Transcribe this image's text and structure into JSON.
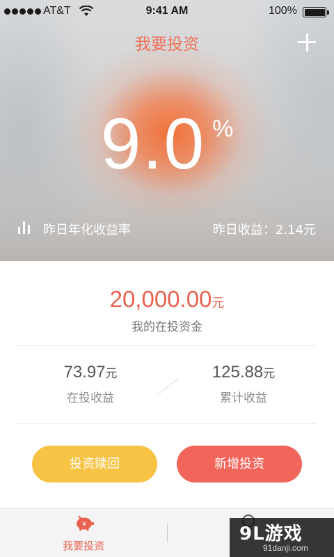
{
  "status_bar": {
    "carrier": "AT&T",
    "time": "9:41 AM",
    "battery": "100%"
  },
  "header": {
    "title": "我要投资",
    "add_icon": "plus-icon"
  },
  "hero": {
    "rate_value": "9.0",
    "rate_unit": "%",
    "rate_label": "昨日年化收益率",
    "yesterday_income": "昨日收益：2.14元",
    "chart_icon": "bar-chart-icon",
    "accent_color": "#f36c30"
  },
  "summary": {
    "total_amount": "20,000.00",
    "total_unit": "元",
    "total_label": "我的在投资金",
    "left_stat": {
      "value": "73.97",
      "unit": "元",
      "label": "在投收益"
    },
    "right_stat": {
      "value": "125.88",
      "unit": "元",
      "label": "累计收益"
    },
    "amount_color": "#e9614f"
  },
  "actions": {
    "redeem_label": "投资赎回",
    "new_label": "新增投资",
    "redeem_color": "#f7c344",
    "new_color": "#f1655a"
  },
  "tabbar": {
    "invest_label": "我要投资",
    "invest_icon": "piggy-bank-icon",
    "other_icon": "search-icon"
  },
  "watermark": {
    "title": "9L游戏",
    "subtitle": "91danji.com"
  }
}
